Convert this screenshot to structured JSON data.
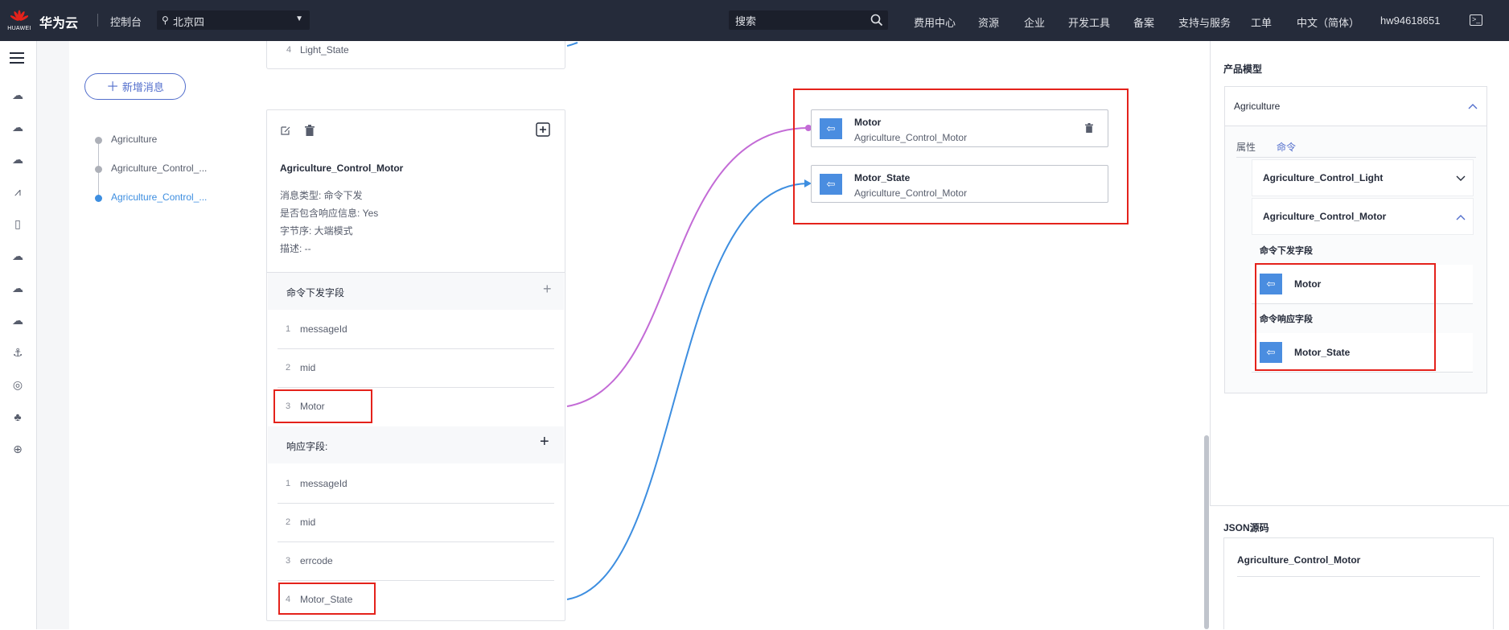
{
  "topbar": {
    "logo_text": "HUAWEI",
    "brand": "华为云",
    "console": "控制台",
    "region": "北京四",
    "search_placeholder": "搜索",
    "nav": [
      "费用中心",
      "资源",
      "企业",
      "开发工具",
      "备案",
      "支持与服务",
      "工单",
      "中文（简体）",
      "hw94618651"
    ]
  },
  "left_panel": {
    "add_message_button": "新增消息",
    "tree": [
      "Agriculture",
      "Agriculture_Control_...",
      "Agriculture_Control_..."
    ]
  },
  "message_card": {
    "prev_field": {
      "index": "4",
      "name": "Light_State"
    },
    "title": "Agriculture_Control_Motor",
    "meta": [
      "消息类型: 命令下发",
      "是否包含响应信息: Yes",
      "字节序: 大端模式",
      "描述: --"
    ],
    "command_section": "命令下发字段",
    "command_fields": [
      {
        "index": "1",
        "name": "messageId"
      },
      {
        "index": "2",
        "name": "mid"
      },
      {
        "index": "3",
        "name": "Motor"
      }
    ],
    "response_section": "响应字段:",
    "response_fields": [
      {
        "index": "1",
        "name": "messageId"
      },
      {
        "index": "2",
        "name": "mid"
      },
      {
        "index": "3",
        "name": "errcode"
      },
      {
        "index": "4",
        "name": "Motor_State"
      }
    ]
  },
  "mapping_targets": [
    {
      "name": "Motor",
      "service": "Agriculture_Control_Motor"
    },
    {
      "name": "Motor_State",
      "service": "Agriculture_Control_Motor"
    }
  ],
  "colors": {
    "link_command": "#c36bd6",
    "link_response": "#3d8ee0",
    "highlight": "#e4221b",
    "accent": "#526ecc"
  },
  "right_panel": {
    "title": "产品模型",
    "product": "Agriculture",
    "tabs": [
      "属性",
      "命令"
    ],
    "commands": [
      "Agriculture_Control_Light",
      "Agriculture_Control_Motor"
    ],
    "command_fields_label": "命令下发字段",
    "command_field": "Motor",
    "response_fields_label": "命令响应字段",
    "response_field": "Motor_State",
    "json_title": "JSON源码",
    "json_item": "Agriculture_Control_Motor"
  }
}
